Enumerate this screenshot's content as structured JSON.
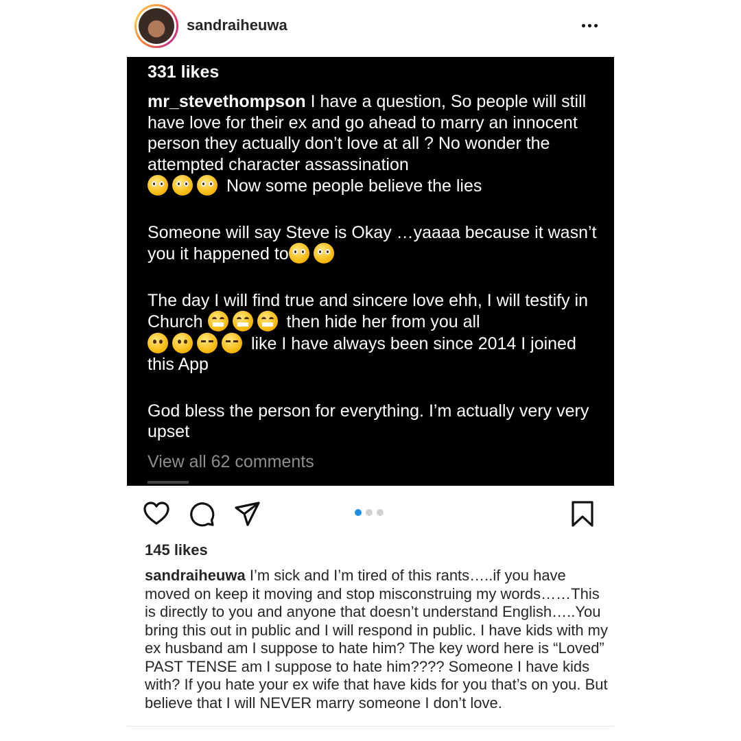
{
  "header": {
    "username": "sandraiheuwa",
    "more_icon": "more-horizontal-icon"
  },
  "screenshot": {
    "likes": "331 likes",
    "comment_user": "mr_stevethompson",
    "p1_a": "I have a question,  So people will still  have love for their ex and go ahead to marry an innocent person they actually don’t love at all ? No wonder the attempted character assassination",
    "p1_b": "Now some people believe the lies",
    "p2": "Someone will say Steve is Okay …yaaaa because it wasn’t you it happened to",
    "p3_a": "The day I will find true and sincere love ehh, I will testify in Church",
    "p3_b": "then hide her from you all",
    "p3_c": "like I have always been since 2014 I joined this App",
    "p4": "God bless the person for everything.  I’m actually very very upset",
    "view_all": "View all 62 comments",
    "emoji_names": [
      "pleading-face",
      "grinning-face",
      "frowning-face",
      "face-with-steam"
    ]
  },
  "actions": {
    "like_icon": "heart-icon",
    "comment_icon": "comment-icon",
    "share_icon": "send-icon",
    "save_icon": "bookmark-icon",
    "carousel_total": 3,
    "carousel_active": 1,
    "accent": "#1f8fe6"
  },
  "post": {
    "likes": "145 likes",
    "caption_user": "sandraiheuwa",
    "caption": "I’m sick and I’m tired of this rants…..if you have moved on keep it moving and stop misconstruing my words……This is directly to you and anyone that doesn’t understand English…..You bring this out in public and I will respond in public. I have kids with my ex husband am I suppose to hate him? The key word here is “Loved” PAST TENSE am I suppose to hate him???? Someone I have kids with? If you hate your ex wife that have kids for you that’s on you. But believe that I will NEVER marry someone I don’t love."
  }
}
